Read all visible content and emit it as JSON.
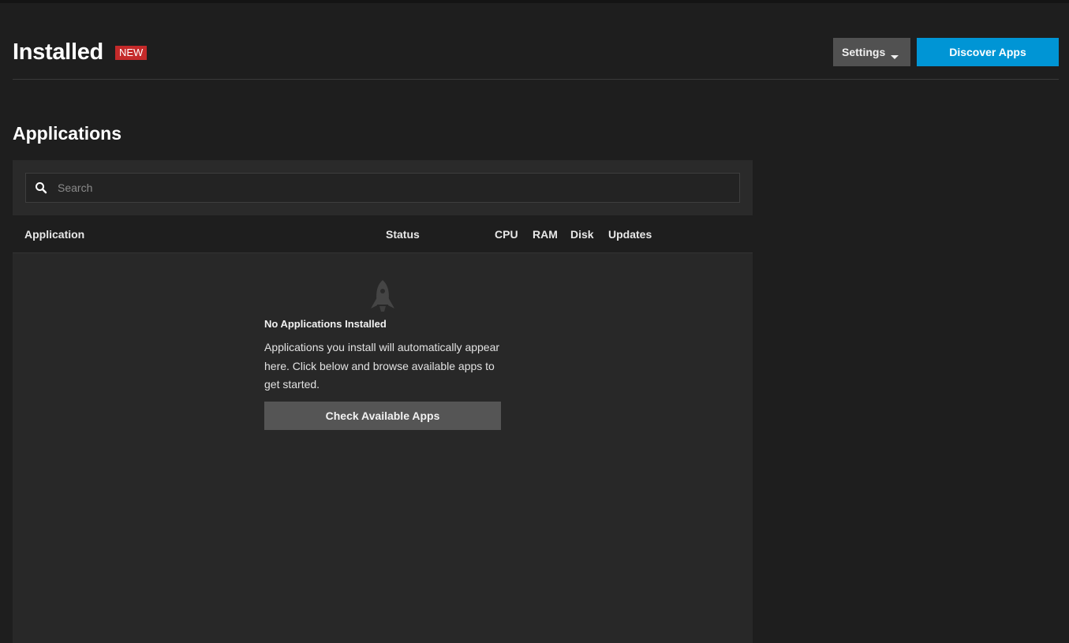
{
  "header": {
    "title": "Installed",
    "badge": "NEW",
    "settings_label": "Settings",
    "discover_label": "Discover Apps"
  },
  "section": {
    "title": "Applications"
  },
  "search": {
    "placeholder": "Search",
    "value": ""
  },
  "table": {
    "columns": [
      "Application",
      "Status",
      "CPU",
      "RAM",
      "Disk",
      "Updates"
    ]
  },
  "empty_state": {
    "icon": "rocket-icon",
    "title": "No Applications Installed",
    "message": "Applications you install will automatically appear here. Click below and browse available apps to get started.",
    "button_label": "Check Available Apps"
  },
  "colors": {
    "background": "#1e1e1e",
    "primary": "#0095d5",
    "badge": "#c42a2a",
    "secondary_button": "#515151"
  }
}
